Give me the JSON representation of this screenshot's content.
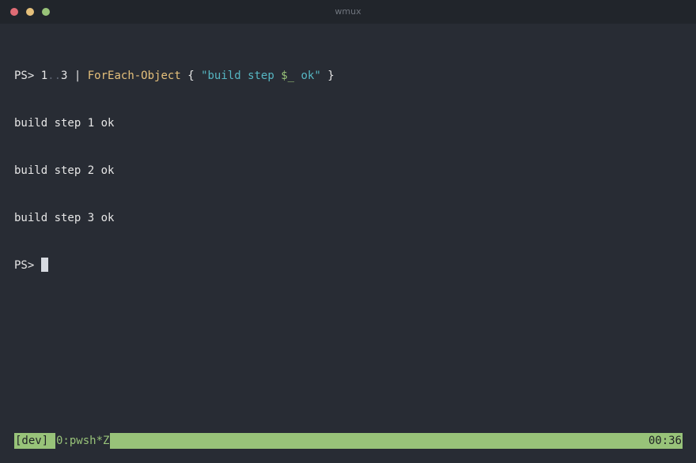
{
  "window": {
    "title": "wmux",
    "controls": [
      "close",
      "minimize",
      "maximize"
    ]
  },
  "terminal": {
    "command_line": {
      "prompt": "PS> ",
      "range_start": "1",
      "range_op": "..",
      "range_end": "3",
      "pipe": " | ",
      "cmdlet": "ForEach-Object",
      "open_brace": " { ",
      "string_start": "\"build step ",
      "variable": "$_",
      "string_end": " ok\"",
      "close_brace": " }"
    },
    "output": [
      "build step 1 ok",
      "build step 2 ok",
      "build step 3 ok"
    ],
    "current_prompt": "PS> "
  },
  "statusbar": {
    "session": "[dev]",
    "window_entry": "0:pwsh*Z",
    "time": "00:36"
  },
  "colors": {
    "background": "#282c34",
    "titlebar": "#21252b",
    "status_green": "#98c379",
    "string": "#56b6c2",
    "cmdlet": "#e5c07b"
  }
}
